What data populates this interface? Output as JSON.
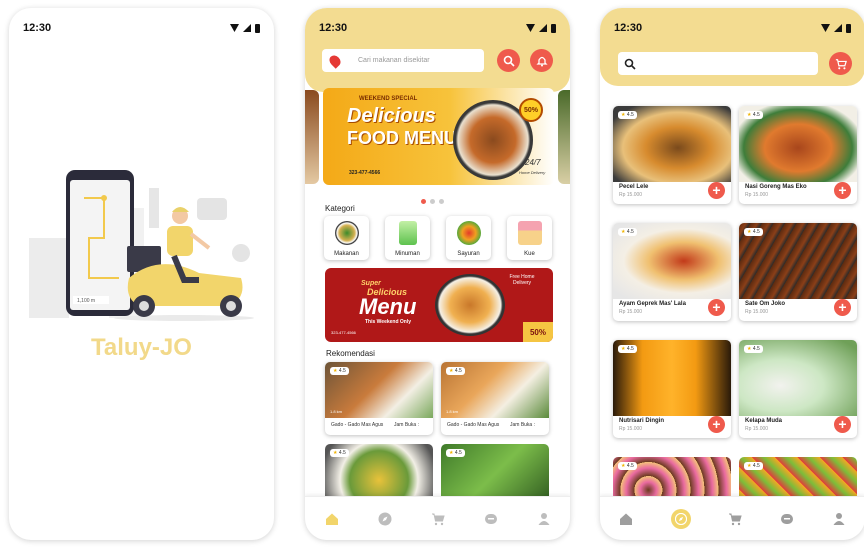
{
  "status": {
    "time": "12:30"
  },
  "splash": {
    "app_name": "Taluy-JO",
    "map_distance": "1,100 m"
  },
  "home": {
    "search_placeholder": "Cari makanan disekitar",
    "banner1": {
      "tag": "WEEKEND SPECIAL",
      "line1": "Delicious",
      "line2": "FOOD MENU",
      "discount": "50%",
      "delivery": "24/7",
      "delivery_sub": "Home Delivery",
      "phone": "323-477-4566"
    },
    "kategori_label": "Kategori",
    "categories": [
      {
        "label": "Makanan",
        "color": "#e8f0e0"
      },
      {
        "label": "Minuman",
        "color": "#d9f3d2"
      },
      {
        "label": "Sayuran",
        "color": "#f7e3c7"
      },
      {
        "label": "Kue",
        "color": "#fbe1e4"
      }
    ],
    "banner2": {
      "line1": "Super",
      "line2": "Delicious",
      "line3": "Menu",
      "line4": "This Weekend Only",
      "phone": "323-477-4566",
      "free": "Free Home Delivery",
      "discount": "50%"
    },
    "rekomendasi_label": "Rekomendasi",
    "recommendations": [
      {
        "rating": "4.5",
        "distance": "1.8 km",
        "name": "Gado - Gado Mas Agus",
        "hours": "Jam Buka :"
      },
      {
        "rating": "4.5",
        "distance": "1.8 km",
        "name": "Gado - Gado Mas Agus",
        "hours": "Jam Buka :"
      },
      {
        "rating": "4.5"
      },
      {
        "rating": "4.5"
      }
    ]
  },
  "list": {
    "products": [
      {
        "rating": "4.5",
        "name": "Pecel Lele",
        "price": "Rp 15.000",
        "colors": [
          "#7a4a1c",
          "#d78b2e",
          "#e8c07a"
        ]
      },
      {
        "rating": "4.5",
        "name": "Nasi Goreng Mas Eko",
        "price": "Rp 15.000",
        "colors": [
          "#a8461c",
          "#e07a2e",
          "#3e7d3a"
        ]
      },
      {
        "rating": "4.5",
        "name": "Ayam Geprek Mas' Lala",
        "price": "Rp 15.000",
        "colors": [
          "#f4efe5",
          "#c23a1a",
          "#f0c070"
        ]
      },
      {
        "rating": "4.5",
        "name": "Sate Om Joko",
        "price": "Rp 15.000",
        "colors": [
          "#5a2a10",
          "#8b3f18",
          "#2b2b2b"
        ]
      },
      {
        "rating": "4.5",
        "name": "Nutrisari Dingin",
        "price": "Rp 15.000",
        "colors": [
          "#f39a12",
          "#ffb32a",
          "#2a1a0a"
        ]
      },
      {
        "rating": "4.5",
        "name": "Kelapa Muda",
        "price": "Rp 15.000",
        "colors": [
          "#cde7c4",
          "#f2f2ee",
          "#6fa058"
        ]
      },
      {
        "rating": "4.5",
        "colors": [
          "#6b3a1e",
          "#e96aa0",
          "#f5c27a"
        ]
      },
      {
        "rating": "4.5",
        "colors": [
          "#e23b3b",
          "#7cbd3a",
          "#f5a623"
        ]
      }
    ]
  },
  "theme": {
    "accent": "#ef5a4c",
    "header": "#f3dc91",
    "title": "#f2d98a"
  }
}
